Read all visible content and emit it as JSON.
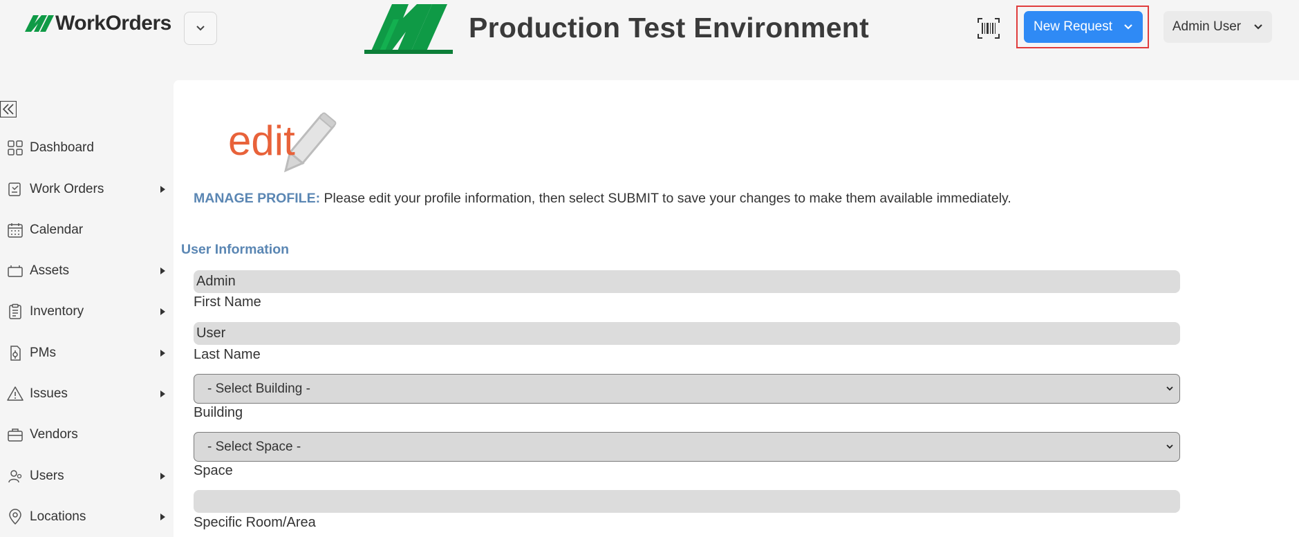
{
  "header": {
    "brand_name": "WorkOrders",
    "env_title": "Production Test Environment",
    "new_request_label": "New Request",
    "user_label": "Admin User",
    "brand_color": "#0f9a46",
    "accent_color": "#2f8af5"
  },
  "sidebar": {
    "items": [
      {
        "label": "Dashboard",
        "icon": "grid-icon",
        "has_submenu": false
      },
      {
        "label": "Work Orders",
        "icon": "work-order-icon",
        "has_submenu": true
      },
      {
        "label": "Calendar",
        "icon": "calendar-icon",
        "has_submenu": false
      },
      {
        "label": "Assets",
        "icon": "asset-icon",
        "has_submenu": true
      },
      {
        "label": "Inventory",
        "icon": "clipboard-icon",
        "has_submenu": true
      },
      {
        "label": "PMs",
        "icon": "pm-icon",
        "has_submenu": true
      },
      {
        "label": "Issues",
        "icon": "warning-icon",
        "has_submenu": true
      },
      {
        "label": "Vendors",
        "icon": "briefcase-icon",
        "has_submenu": false
      },
      {
        "label": "Users",
        "icon": "users-icon",
        "has_submenu": true
      },
      {
        "label": "Locations",
        "icon": "location-pin-icon",
        "has_submenu": true
      }
    ]
  },
  "main": {
    "edit_graphic_text": "edit",
    "intro_title": "MANAGE PROFILE:",
    "intro_text": " Please edit your profile information, then select SUBMIT to save your changes to make them available immediately.",
    "section_title": "User Information",
    "fields": {
      "first_name": {
        "value": "Admin",
        "label": "First Name"
      },
      "last_name": {
        "value": "User",
        "label": "Last Name"
      },
      "building": {
        "value": "- Select Building -",
        "label": "Building"
      },
      "space": {
        "value": "- Select Space -",
        "label": "Space"
      },
      "room": {
        "value": "",
        "label": "Specific Room/Area"
      }
    }
  }
}
